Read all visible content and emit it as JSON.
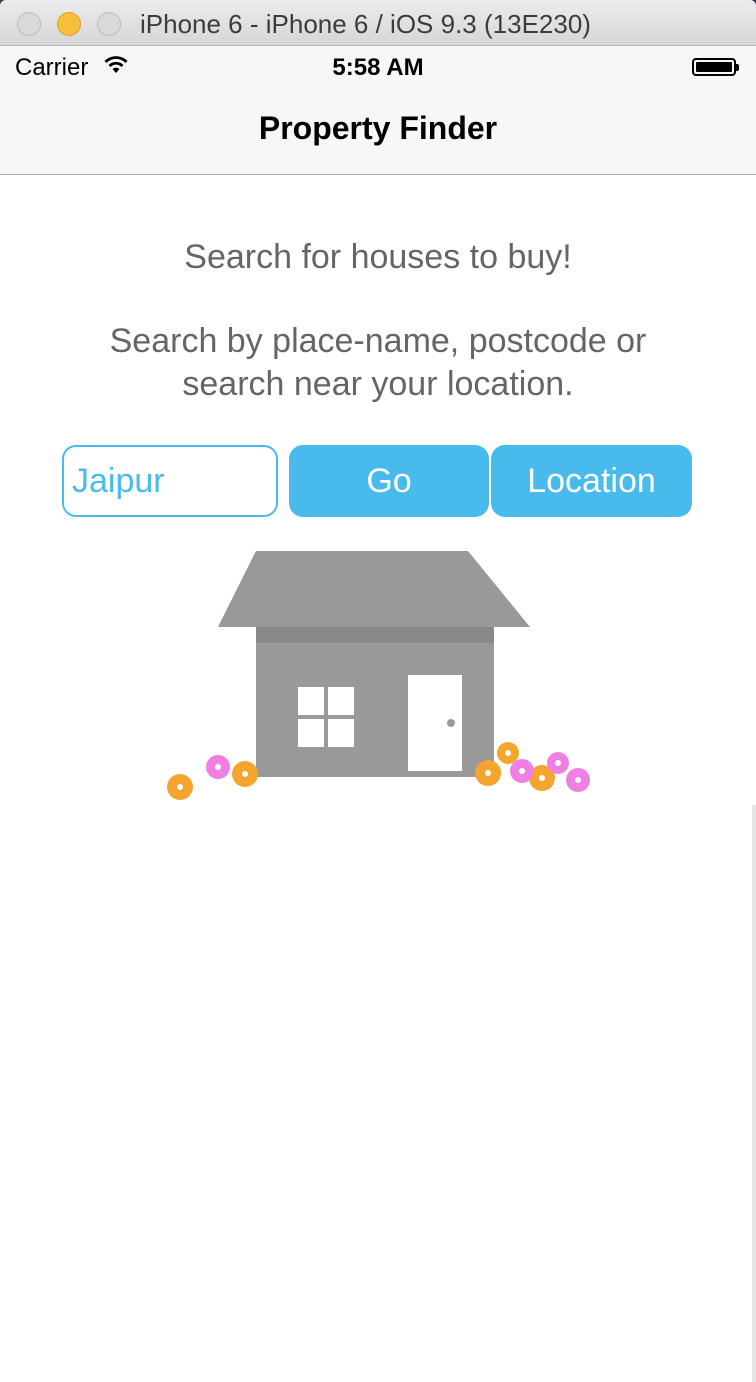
{
  "window": {
    "title": "iPhone 6 - iPhone 6 / iOS 9.3 (13E230)"
  },
  "status_bar": {
    "carrier": "Carrier",
    "time": "5:58 AM",
    "icons": [
      "wifi-icon",
      "battery-icon"
    ]
  },
  "nav": {
    "title": "Property Finder"
  },
  "main": {
    "description": "Search for houses to buy!",
    "instructions": "Search by place-name, postcode or search near your location.",
    "search": {
      "value": "Jaipur"
    },
    "go_label": "Go",
    "location_label": "Location"
  },
  "colors": {
    "accent": "#48bbec",
    "text": "#656565",
    "house": "#999999"
  }
}
